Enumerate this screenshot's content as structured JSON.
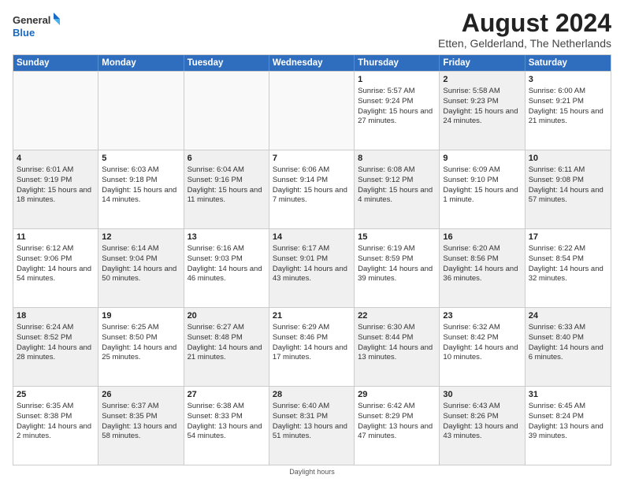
{
  "logo": {
    "text_general": "General",
    "text_blue": "Blue"
  },
  "title": "August 2024",
  "subtitle": "Etten, Gelderland, The Netherlands",
  "header_days": [
    "Sunday",
    "Monday",
    "Tuesday",
    "Wednesday",
    "Thursday",
    "Friday",
    "Saturday"
  ],
  "footer": "Daylight hours",
  "weeks": [
    [
      {
        "day": "",
        "info": "",
        "shaded": false,
        "empty": true
      },
      {
        "day": "",
        "info": "",
        "shaded": false,
        "empty": true
      },
      {
        "day": "",
        "info": "",
        "shaded": false,
        "empty": true
      },
      {
        "day": "",
        "info": "",
        "shaded": false,
        "empty": true
      },
      {
        "day": "1",
        "info": "Sunrise: 5:57 AM\nSunset: 9:24 PM\nDaylight: 15 hours and 27 minutes.",
        "shaded": false,
        "empty": false
      },
      {
        "day": "2",
        "info": "Sunrise: 5:58 AM\nSunset: 9:23 PM\nDaylight: 15 hours and 24 minutes.",
        "shaded": true,
        "empty": false
      },
      {
        "day": "3",
        "info": "Sunrise: 6:00 AM\nSunset: 9:21 PM\nDaylight: 15 hours and 21 minutes.",
        "shaded": false,
        "empty": false
      }
    ],
    [
      {
        "day": "4",
        "info": "Sunrise: 6:01 AM\nSunset: 9:19 PM\nDaylight: 15 hours and 18 minutes.",
        "shaded": true,
        "empty": false
      },
      {
        "day": "5",
        "info": "Sunrise: 6:03 AM\nSunset: 9:18 PM\nDaylight: 15 hours and 14 minutes.",
        "shaded": false,
        "empty": false
      },
      {
        "day": "6",
        "info": "Sunrise: 6:04 AM\nSunset: 9:16 PM\nDaylight: 15 hours and 11 minutes.",
        "shaded": true,
        "empty": false
      },
      {
        "day": "7",
        "info": "Sunrise: 6:06 AM\nSunset: 9:14 PM\nDaylight: 15 hours and 7 minutes.",
        "shaded": false,
        "empty": false
      },
      {
        "day": "8",
        "info": "Sunrise: 6:08 AM\nSunset: 9:12 PM\nDaylight: 15 hours and 4 minutes.",
        "shaded": true,
        "empty": false
      },
      {
        "day": "9",
        "info": "Sunrise: 6:09 AM\nSunset: 9:10 PM\nDaylight: 15 hours and 1 minute.",
        "shaded": false,
        "empty": false
      },
      {
        "day": "10",
        "info": "Sunrise: 6:11 AM\nSunset: 9:08 PM\nDaylight: 14 hours and 57 minutes.",
        "shaded": true,
        "empty": false
      }
    ],
    [
      {
        "day": "11",
        "info": "Sunrise: 6:12 AM\nSunset: 9:06 PM\nDaylight: 14 hours and 54 minutes.",
        "shaded": false,
        "empty": false
      },
      {
        "day": "12",
        "info": "Sunrise: 6:14 AM\nSunset: 9:04 PM\nDaylight: 14 hours and 50 minutes.",
        "shaded": true,
        "empty": false
      },
      {
        "day": "13",
        "info": "Sunrise: 6:16 AM\nSunset: 9:03 PM\nDaylight: 14 hours and 46 minutes.",
        "shaded": false,
        "empty": false
      },
      {
        "day": "14",
        "info": "Sunrise: 6:17 AM\nSunset: 9:01 PM\nDaylight: 14 hours and 43 minutes.",
        "shaded": true,
        "empty": false
      },
      {
        "day": "15",
        "info": "Sunrise: 6:19 AM\nSunset: 8:59 PM\nDaylight: 14 hours and 39 minutes.",
        "shaded": false,
        "empty": false
      },
      {
        "day": "16",
        "info": "Sunrise: 6:20 AM\nSunset: 8:56 PM\nDaylight: 14 hours and 36 minutes.",
        "shaded": true,
        "empty": false
      },
      {
        "day": "17",
        "info": "Sunrise: 6:22 AM\nSunset: 8:54 PM\nDaylight: 14 hours and 32 minutes.",
        "shaded": false,
        "empty": false
      }
    ],
    [
      {
        "day": "18",
        "info": "Sunrise: 6:24 AM\nSunset: 8:52 PM\nDaylight: 14 hours and 28 minutes.",
        "shaded": true,
        "empty": false
      },
      {
        "day": "19",
        "info": "Sunrise: 6:25 AM\nSunset: 8:50 PM\nDaylight: 14 hours and 25 minutes.",
        "shaded": false,
        "empty": false
      },
      {
        "day": "20",
        "info": "Sunrise: 6:27 AM\nSunset: 8:48 PM\nDaylight: 14 hours and 21 minutes.",
        "shaded": true,
        "empty": false
      },
      {
        "day": "21",
        "info": "Sunrise: 6:29 AM\nSunset: 8:46 PM\nDaylight: 14 hours and 17 minutes.",
        "shaded": false,
        "empty": false
      },
      {
        "day": "22",
        "info": "Sunrise: 6:30 AM\nSunset: 8:44 PM\nDaylight: 14 hours and 13 minutes.",
        "shaded": true,
        "empty": false
      },
      {
        "day": "23",
        "info": "Sunrise: 6:32 AM\nSunset: 8:42 PM\nDaylight: 14 hours and 10 minutes.",
        "shaded": false,
        "empty": false
      },
      {
        "day": "24",
        "info": "Sunrise: 6:33 AM\nSunset: 8:40 PM\nDaylight: 14 hours and 6 minutes.",
        "shaded": true,
        "empty": false
      }
    ],
    [
      {
        "day": "25",
        "info": "Sunrise: 6:35 AM\nSunset: 8:38 PM\nDaylight: 14 hours and 2 minutes.",
        "shaded": false,
        "empty": false
      },
      {
        "day": "26",
        "info": "Sunrise: 6:37 AM\nSunset: 8:35 PM\nDaylight: 13 hours and 58 minutes.",
        "shaded": true,
        "empty": false
      },
      {
        "day": "27",
        "info": "Sunrise: 6:38 AM\nSunset: 8:33 PM\nDaylight: 13 hours and 54 minutes.",
        "shaded": false,
        "empty": false
      },
      {
        "day": "28",
        "info": "Sunrise: 6:40 AM\nSunset: 8:31 PM\nDaylight: 13 hours and 51 minutes.",
        "shaded": true,
        "empty": false
      },
      {
        "day": "29",
        "info": "Sunrise: 6:42 AM\nSunset: 8:29 PM\nDaylight: 13 hours and 47 minutes.",
        "shaded": false,
        "empty": false
      },
      {
        "day": "30",
        "info": "Sunrise: 6:43 AM\nSunset: 8:26 PM\nDaylight: 13 hours and 43 minutes.",
        "shaded": true,
        "empty": false
      },
      {
        "day": "31",
        "info": "Sunrise: 6:45 AM\nSunset: 8:24 PM\nDaylight: 13 hours and 39 minutes.",
        "shaded": false,
        "empty": false
      }
    ]
  ]
}
